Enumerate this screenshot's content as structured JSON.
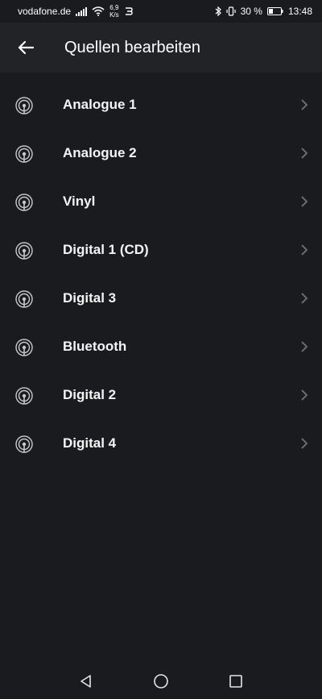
{
  "status_bar": {
    "carrier": "vodafone.de",
    "net_speed_value": "6,9",
    "net_speed_unit": "K/s",
    "battery_percent": "30 %",
    "time": "13:48"
  },
  "header": {
    "title": "Quellen bearbeiten"
  },
  "sources": [
    {
      "label": "Analogue 1"
    },
    {
      "label": "Analogue 2"
    },
    {
      "label": "Vinyl"
    },
    {
      "label": "Digital 1 (CD)"
    },
    {
      "label": "Digital 3"
    },
    {
      "label": "Bluetooth"
    },
    {
      "label": "Digital 2"
    },
    {
      "label": "Digital 4"
    }
  ],
  "icons": {
    "back": "arrow-left-icon",
    "source": "broadcast-icon",
    "chevron": "chevron-right-icon",
    "nav_back": "triangle-back-icon",
    "nav_home": "circle-home-icon",
    "nav_recents": "square-recents-icon"
  },
  "colors": {
    "background": "#1a1b1e",
    "header_background": "#222327",
    "text": "#f4f4f4",
    "icon_gray": "#c8c8c8",
    "chevron_gray": "#6b6b6e"
  }
}
